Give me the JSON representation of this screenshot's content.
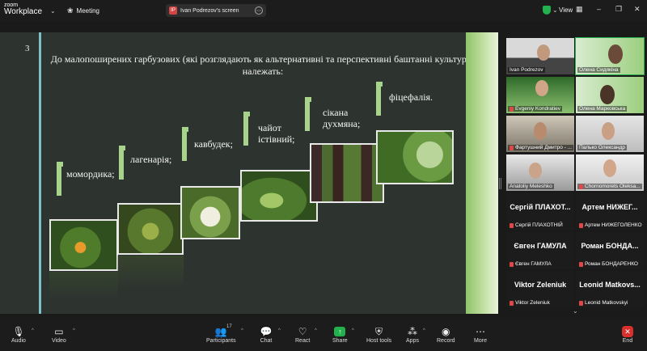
{
  "app": {
    "logo_line1": "zoom",
    "logo_line2": "Workplace"
  },
  "topbar": {
    "meeting_label": "Meeting",
    "share_owner": "Ivan Podrezov's screen",
    "share_initial": "IP",
    "view_label": "View",
    "colors": {
      "secure": "#23b14d",
      "share_badge": "#d24545"
    }
  },
  "slide": {
    "number": "3",
    "title": "До малопоширених гарбузових (які розглядають як альтернативні та перспективні баштанні культури) належать:",
    "steps": [
      "момордика;",
      "лагенарія;",
      "кавбудек;",
      "чайот істівний;",
      "сікана духмяна;",
      "фіцефалія."
    ],
    "accent_color": "#a7d48a"
  },
  "participants": [
    {
      "name": "Ivan Podrezov",
      "muted": false,
      "kind": "video"
    },
    {
      "name": "Олена Сидякіна",
      "muted": false,
      "kind": "video"
    },
    {
      "name": "Evgeniy Kondratiev",
      "muted": true,
      "kind": "video"
    },
    {
      "name": "Олена Марковська",
      "muted": false,
      "kind": "video"
    },
    {
      "name": "Фартушний Дмитро - ...",
      "muted": true,
      "kind": "video"
    },
    {
      "name": "Палько Олександр",
      "muted": false,
      "kind": "video"
    },
    {
      "name": "Anatoliy Meleshko",
      "muted": false,
      "kind": "video"
    },
    {
      "name": "Chornomorets Oleksa...",
      "muted": true,
      "kind": "video"
    },
    {
      "display": "Сергій ПЛАХОТ...",
      "name": "Сергій ПЛАХОТНІЙ",
      "muted": true,
      "kind": "name"
    },
    {
      "display": "Артем НИЖЕГ...",
      "name": "Артем НИЖЕГОЛЕНКО",
      "muted": true,
      "kind": "name"
    },
    {
      "display": "Євген ГАМУЛА",
      "name": "Євген ГАМУЛА",
      "muted": true,
      "kind": "name"
    },
    {
      "display": "Роман БОНДА...",
      "name": "Роман БОНДАРЕНКО",
      "muted": true,
      "kind": "name"
    },
    {
      "display": "Viktor Zeleniuk",
      "name": "Viktor Zeleniuk",
      "muted": true,
      "kind": "name"
    },
    {
      "display": "Leonid Matkovs...",
      "name": "Leonid Matkovskyi",
      "muted": true,
      "kind": "name"
    }
  ],
  "toolbar": {
    "audio": "Audio",
    "video": "Video",
    "participants": "Participants",
    "participants_count": "17",
    "chat": "Chat",
    "react": "React",
    "share": "Share",
    "host_tools": "Host tools",
    "apps": "Apps",
    "record": "Record",
    "more": "More",
    "end": "End",
    "colors": {
      "share": "#23b14d",
      "end": "#d9302c"
    }
  }
}
